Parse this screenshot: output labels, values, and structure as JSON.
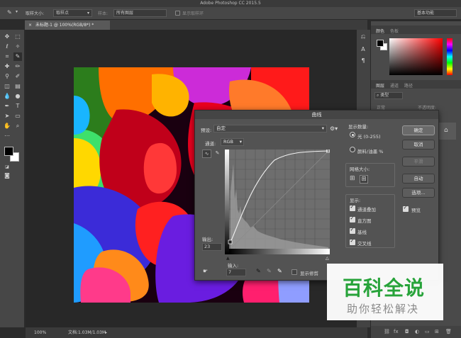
{
  "window": {
    "title": "Adobe Photoshop CC 2015.5"
  },
  "options_bar": {
    "sample_size_label": "取样大小:",
    "sample_size_value": "取样点",
    "sample_label": "样本:",
    "sample_value": "所有图层",
    "show_ring_label": "显示取样环",
    "workspace_value": "基本功能"
  },
  "document": {
    "tab_title": "未标题-1 @ 100%(RGB/8*) *"
  },
  "status": {
    "zoom": "100%",
    "doc_size": "文档:1.03M/1.03M"
  },
  "right_panel": {
    "color_tab": "颜色",
    "swatches_tab": "色板",
    "layers_tab": "图层",
    "channels_tab": "通道",
    "paths_tab": "路径",
    "kind_filter": "类型",
    "blend_mode": "正常",
    "opacity_label": "不透明度:"
  },
  "curves_dialog": {
    "title": "曲线",
    "preset_label": "预设:",
    "preset_value": "自定",
    "channel_label": "通道:",
    "channel_value": "RGB",
    "output_label": "输出:",
    "output_value": "23",
    "input_label": "输入:",
    "input_value": "7",
    "show_clipping_label": "显示修剪",
    "show_amount_label": "显示数量:",
    "light_option": "光 (0-255)",
    "pigment_option": "颜料/油墨 %",
    "grid_size_label": "网格大小:",
    "show_label": "显示:",
    "show_options": [
      "通道叠加",
      "直方图",
      "基线",
      "交叉线"
    ],
    "buttons": {
      "ok": "确定",
      "cancel": "取消",
      "smooth": "平滑",
      "auto": "自动",
      "options": "选项..."
    },
    "preview_label": "预览"
  },
  "watermark": {
    "main": "百科全说",
    "sub": "助你轻松解决"
  },
  "colors": {
    "accent_green": "#27a33a",
    "foreground": "#000000",
    "background": "#ffffff"
  }
}
